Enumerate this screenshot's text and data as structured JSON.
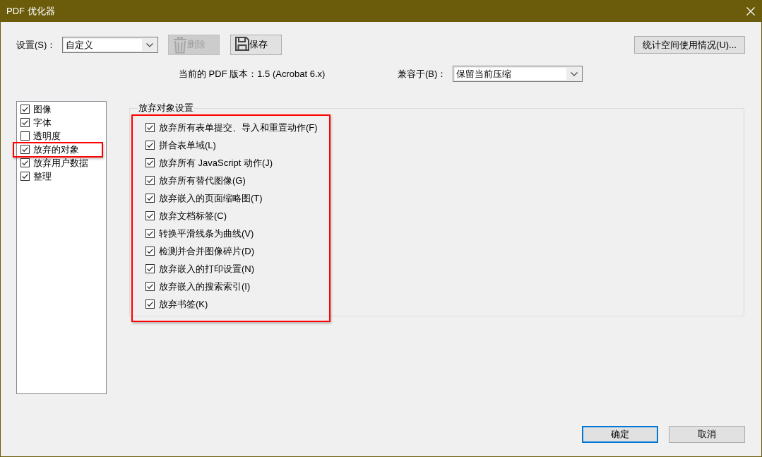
{
  "window": {
    "title": "PDF 优化器"
  },
  "toolbar": {
    "settings_label": "设置(S)：",
    "settings_dropdown": {
      "value": "自定义"
    },
    "delete_button": {
      "label": "删除",
      "disabled": true
    },
    "save_button": {
      "label": "保存",
      "disabled": false
    },
    "audit_button": {
      "label": "统计空间使用情况(U)..."
    }
  },
  "version_info": "当前的 PDF 版本：1.5 (Acrobat 6.x)",
  "compatibility": {
    "label": "兼容于(B)：",
    "dropdown": {
      "value": "保留当前压缩"
    }
  },
  "sidebar": {
    "items": [
      {
        "label": "图像",
        "checked": true,
        "highlighted": false
      },
      {
        "label": "字体",
        "checked": true,
        "highlighted": false
      },
      {
        "label": "透明度",
        "checked": false,
        "highlighted": false
      },
      {
        "label": "放弃的对象",
        "checked": true,
        "highlighted": true
      },
      {
        "label": "放弃用户数据",
        "checked": true,
        "highlighted": false
      },
      {
        "label": "整理",
        "checked": true,
        "highlighted": false
      }
    ]
  },
  "options_panel": {
    "title": "放弃对象设置",
    "highlighted": true,
    "options": [
      {
        "label": "放弃所有表单提交、导入和重置动作(F)",
        "checked": true
      },
      {
        "label": "拼合表单域(L)",
        "checked": true
      },
      {
        "label": "放弃所有 JavaScript 动作(J)",
        "checked": true
      },
      {
        "label": "放弃所有替代图像(G)",
        "checked": true
      },
      {
        "label": "放弃嵌入的页面缩略图(T)",
        "checked": true
      },
      {
        "label": "放弃文档标签(C)",
        "checked": true
      },
      {
        "label": "转换平滑线条为曲线(V)",
        "checked": true
      },
      {
        "label": "检测并合并图像碎片(D)",
        "checked": true
      },
      {
        "label": "放弃嵌入的打印设置(N)",
        "checked": true
      },
      {
        "label": "放弃嵌入的搜索索引(I)",
        "checked": true
      },
      {
        "label": "放弃书签(K)",
        "checked": true
      }
    ]
  },
  "buttons": [
    {
      "label": "确定",
      "default": true
    },
    {
      "label": "取消",
      "default": false
    }
  ]
}
